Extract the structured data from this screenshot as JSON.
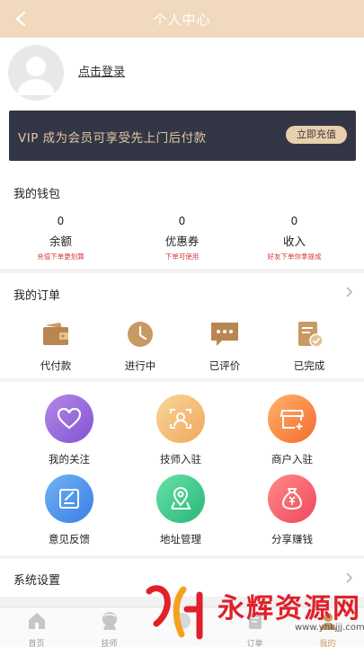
{
  "header": {
    "title": "个人中心"
  },
  "profile": {
    "login_label": "点击登录"
  },
  "vip": {
    "text": "VIP 成为会员可享受先上门后付款",
    "button": "立即充值"
  },
  "wallet": {
    "title": "我的钱包",
    "items": [
      {
        "value": "0",
        "label": "余额",
        "hint": "充值下单更划算"
      },
      {
        "value": "0",
        "label": "优惠券",
        "hint": "下单可使用"
      },
      {
        "value": "0",
        "label": "收入",
        "hint": "好友下单你拿提成"
      }
    ]
  },
  "orders": {
    "title": "我的订单",
    "items": [
      {
        "label": "代付款",
        "icon": "wallet-icon"
      },
      {
        "label": "进行中",
        "icon": "clock-icon"
      },
      {
        "label": "已评价",
        "icon": "comment-icon"
      },
      {
        "label": "已完成",
        "icon": "done-icon"
      }
    ]
  },
  "tools": {
    "items": [
      {
        "label": "我的关注",
        "icon": "heart-icon"
      },
      {
        "label": "技师入驻",
        "icon": "technician-icon"
      },
      {
        "label": "商户入驻",
        "icon": "shop-icon"
      },
      {
        "label": "意见反馈",
        "icon": "feedback-icon"
      },
      {
        "label": "地址管理",
        "icon": "location-icon"
      },
      {
        "label": "分享赚钱",
        "icon": "money-bag-icon"
      }
    ]
  },
  "settings": {
    "title": "系统设置"
  },
  "tabbar": {
    "items": [
      {
        "label": "首页",
        "icon": "home-icon"
      },
      {
        "label": "技师",
        "icon": "technician-tab-icon"
      },
      {
        "label": "",
        "icon": "center-tab-icon"
      },
      {
        "label": "订单",
        "icon": "order-tab-icon"
      },
      {
        "label": "我的",
        "icon": "user-tab-icon"
      }
    ]
  },
  "watermark": {
    "text": "永辉资源网",
    "url": "www.yhkjjj.com"
  },
  "colors": {
    "header": "#f0d9bd",
    "gold": "#c79a63",
    "vip_bg": "#333745",
    "hint_red": "#d53a3a"
  }
}
